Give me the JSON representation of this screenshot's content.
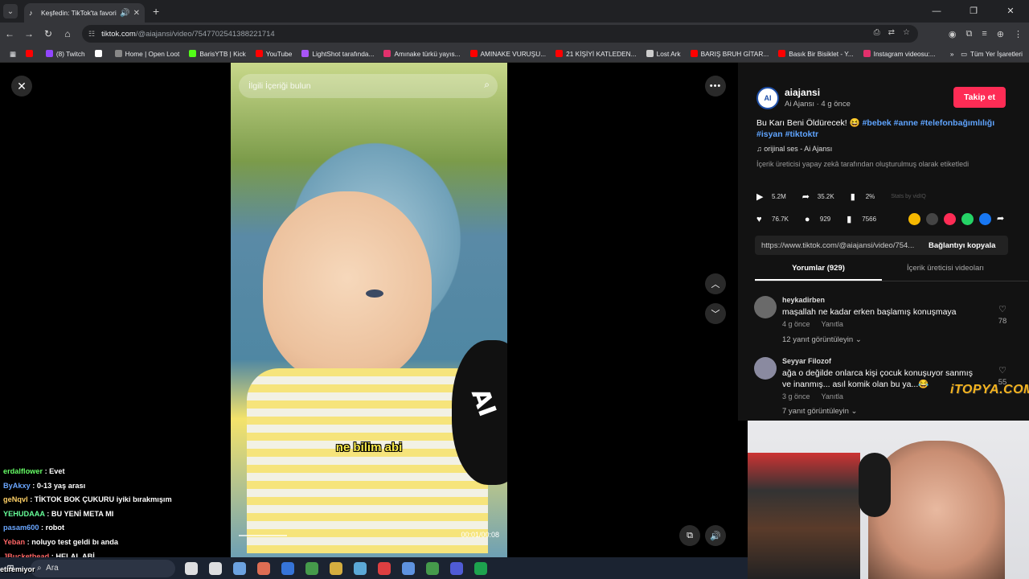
{
  "browser": {
    "tab_title": "Keşfedin: TikTok'ta favori vid",
    "omni_host": "tiktok.com",
    "omni_path": "/@aiajansi/video/7547702541388221714"
  },
  "bookmarks": [
    {
      "label": "",
      "color": "#ff0000"
    },
    {
      "label": "(8) Twitch",
      "color": "#9146ff"
    },
    {
      "label": "",
      "color": "#ffffff"
    },
    {
      "label": "Home | Open Loot",
      "color": "#888888"
    },
    {
      "label": "BarisYTB | Kick",
      "color": "#53fc18"
    },
    {
      "label": "YouTube",
      "color": "#ff0000"
    },
    {
      "label": "LightShot tarafında...",
      "color": "#a855f7"
    },
    {
      "label": "Amınake türkü yayıs...",
      "color": "#e1306c"
    },
    {
      "label": "AMINAKE VURUŞU...",
      "color": "#ff0000"
    },
    {
      "label": "21 KİŞİYİ KATLEDEN...",
      "color": "#ff0000"
    },
    {
      "label": "Lost Ark",
      "color": "#cccccc"
    },
    {
      "label": "BARIŞ BRUH GİTAR...",
      "color": "#ff0000"
    },
    {
      "label": "Basık Bir Bisiklet - Y...",
      "color": "#ff0000"
    },
    {
      "label": "Instagram videosu:...",
      "color": "#e1306c"
    }
  ],
  "bookmarks_all": "Tüm Yer İşaretleri",
  "video": {
    "search_placeholder": "İlgili İçeriği bulun",
    "caption": "ne bilim abi",
    "time": "00:01/00:08"
  },
  "author": {
    "avatar_text": "AI",
    "username": "aiajansi",
    "subline": "Ai Ajansı · 4 g önce",
    "follow_label": "Takip et"
  },
  "description": {
    "text": "Bu Karı Beni Öldürecek! 😆 ",
    "tags": "#bebek #anne #telefonbağımlılığı #isyan #tiktoktr"
  },
  "music": "orijinal ses - Ai Ajansı",
  "ai_label": "İçerik üreticisi yapay zekâ tarafından oluşturulmuş olarak etiketledi",
  "stats1": [
    {
      "icon": "▶",
      "value": "5.2M",
      "name": "play-count"
    },
    {
      "icon": "➦",
      "value": "35.2K",
      "name": "share-count"
    },
    {
      "icon": "▮",
      "value": "2%",
      "name": "engagement-rate"
    }
  ],
  "stats_by": "Stats by vidIQ",
  "stats2": [
    {
      "icon": "♥",
      "value": "76.7K",
      "name": "like-count"
    },
    {
      "icon": "●",
      "value": "929",
      "name": "comment-count"
    },
    {
      "icon": "▮",
      "value": "7566",
      "name": "save-count"
    }
  ],
  "share_colors": [
    "#f5b800",
    "#444444",
    "#fe2c55",
    "#25d366",
    "#1877f2"
  ],
  "link": {
    "url": "https://www.tiktok.com/@aiajansi/video/754...",
    "copy_label": "Bağlantıyı kopyala"
  },
  "panel_tabs": {
    "comments": "Yorumlar (929)",
    "creator_videos": "İçerik üreticisi videoları"
  },
  "comments": [
    {
      "name": "heykadirben",
      "text": "maşallah ne kadar erken başlamış konuşmaya",
      "time": "4 g önce",
      "reply": "Yanıtla",
      "replies": "12 yanıt görüntüleyin",
      "likes": "78"
    },
    {
      "name": "Seyyar Filozof",
      "text": "ağa o değilde onlarca kişi çocuk konuşuyor sanmış ve inanmış... asıl komik olan bu ya...😂",
      "time": "3 g önce",
      "reply": "Yanıtla",
      "replies": "7 yanıt görüntüleyin",
      "likes": "55"
    }
  ],
  "watermark": "iTOPYA.COM",
  "chat": [
    {
      "user": "erdalflower",
      "color": "#66ff66",
      "msg": " : Evet"
    },
    {
      "user": "ByAkxy",
      "color": "#6aa6ff",
      "msg": " : 0-13 yaş arası"
    },
    {
      "user": "geNqvl",
      "color": "#ffd166",
      "msg": " : TİKTOK BOK ÇUKURU iyiki bırakmışım"
    },
    {
      "user": "YEHUDAAA",
      "color": "#66ff99",
      "msg": " : BU YENİ META MI"
    },
    {
      "user": "pasam600",
      "color": "#6aa6ff",
      "msg": " : robot"
    },
    {
      "user": "Yeban",
      "color": "#ff6666",
      "msg": " : noluyo test geldi bı anda"
    },
    {
      "user": "JBucketbead",
      "color": "#ff6666",
      "msg": " : HELAL ABİ"
    }
  ],
  "taskbar": {
    "search": "Ara",
    "stream_label": "etiremiyor",
    "app_colors": [
      "#ffffff",
      "#ffffff",
      "#7ab8ff",
      "#ff7a59",
      "#3b82f6",
      "#4caf50",
      "#f5c542",
      "#66c0f4",
      "#ff4444",
      "#6aa6ff",
      "#4caf50",
      "#5865f2",
      "#1db954"
    ]
  }
}
